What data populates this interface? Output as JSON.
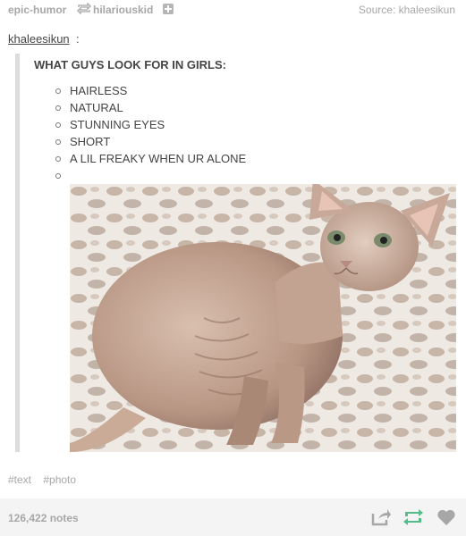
{
  "header": {
    "reblog_from": "epic-humor",
    "reblogger": "hilariouskid",
    "source_label": "Source:",
    "source_user": "khaleesikun"
  },
  "post": {
    "op_user": "khaleesikun",
    "op_colon": ":",
    "heading": "WHAT GUYS LOOK FOR IN GIRLS:",
    "list_items": [
      "HAIRLESS",
      "NATURAL",
      "STUNNING EYES",
      "SHORT",
      "A LIL FREAKY WHEN UR ALONE",
      ""
    ]
  },
  "tags": [
    "#text",
    "#photo"
  ],
  "footer": {
    "notes": "126,422 notes"
  },
  "colors": {
    "reblog_green": "#56bc8a",
    "muted_text": "#a7a7a7",
    "footer_bg": "#f4f4f4"
  },
  "icons": {
    "reblog": "reblog-arrows-icon",
    "follow": "plus-square-icon",
    "share": "share-arrow-icon",
    "reblog_button": "reblog-icon",
    "like": "heart-icon"
  }
}
